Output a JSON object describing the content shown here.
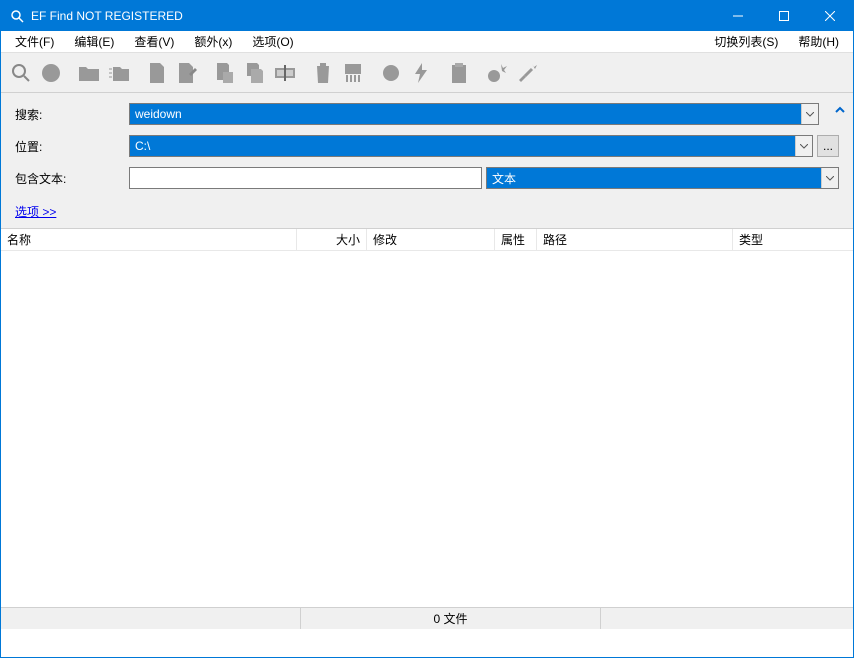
{
  "title": "EF Find NOT REGISTERED",
  "menu": {
    "file": "文件(F)",
    "edit": "编辑(E)",
    "view": "查看(V)",
    "extra": "额外(x)",
    "options": "选项(O)",
    "switchlist": "切换列表(S)",
    "help": "帮助(H)"
  },
  "form": {
    "search_label": "搜索:",
    "search_value": "weidown",
    "location_label": "位置:",
    "location_value": "C:\\",
    "contains_label": "包含文本:",
    "contains_value": "",
    "text_type": "文本",
    "options_link": "选项  >>",
    "browse_btn": "..."
  },
  "columns": {
    "name": "名称",
    "size": "大小",
    "modified": "修改",
    "attributes": "属性",
    "path": "路径",
    "type": "类型"
  },
  "status": {
    "file_count": "0 文件"
  }
}
